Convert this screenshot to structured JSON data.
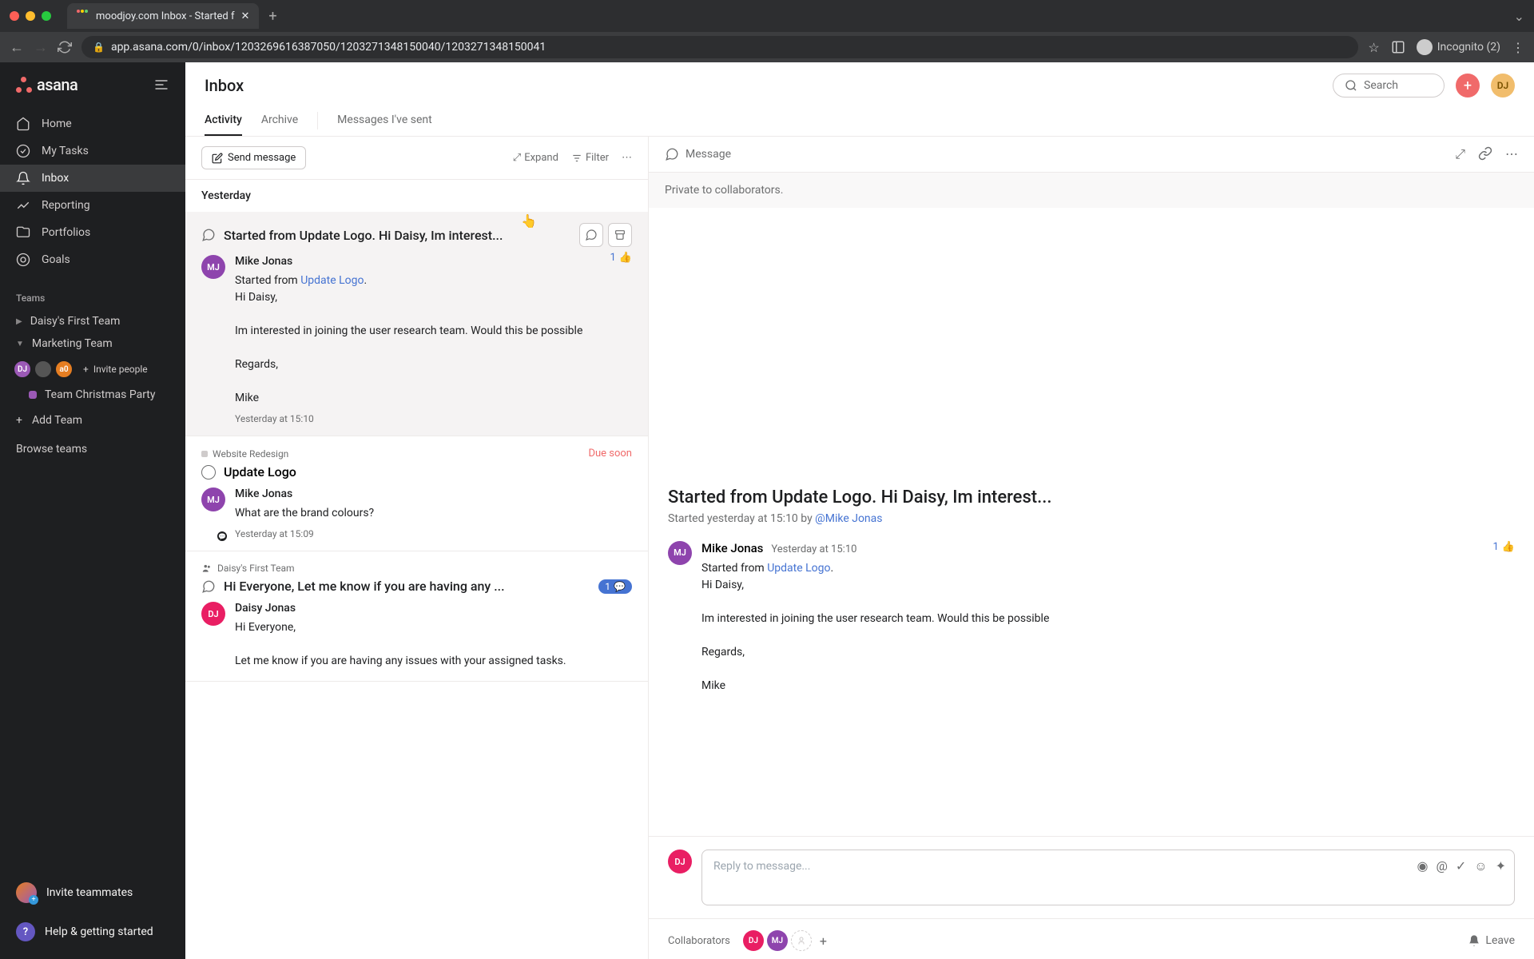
{
  "browser": {
    "tab_title": "moodjoy.com Inbox - Started f",
    "url": "app.asana.com/0/inbox/1203269616387050/1203271348150040/1203271348150041",
    "incognito_label": "Incognito (2)"
  },
  "sidebar": {
    "logo_text": "asana",
    "nav": {
      "home": "Home",
      "my_tasks": "My Tasks",
      "inbox": "Inbox",
      "reporting": "Reporting",
      "portfolios": "Portfolios",
      "goals": "Goals"
    },
    "teams_header": "Teams",
    "teams": [
      {
        "name": "Daisy's First Team"
      },
      {
        "name": "Marketing Team"
      }
    ],
    "invite_people": "Invite people",
    "projects": [
      {
        "name": "Team Christmas Party",
        "color": "#9b59b6"
      }
    ],
    "add_team": "Add Team",
    "browse_teams": "Browse teams",
    "invite_teammates": "Invite teammates",
    "help": "Help & getting started"
  },
  "header": {
    "title": "Inbox",
    "search_placeholder": "Search",
    "user_initials": "DJ",
    "tabs": {
      "activity": "Activity",
      "archive": "Archive",
      "messages_sent": "Messages I've sent"
    }
  },
  "inbox_toolbar": {
    "send_message": "Send message",
    "expand": "Expand",
    "filter": "Filter"
  },
  "date_header": "Yesterday",
  "items": [
    {
      "title": "Started from Update Logo. Hi Daisy, Im interest...",
      "author": "Mike Jonas",
      "author_initials": "MJ",
      "started_from_prefix": "Started from ",
      "started_from_link": "Update Logo",
      "greeting": "Hi Daisy,",
      "body1": "Im interested in joining the user research team. Would this be possible",
      "body2": "Regards,",
      "body3": "Mike",
      "time": "Yesterday at 15:10",
      "like_count": "1"
    },
    {
      "project": "Website Redesign",
      "due": "Due soon",
      "task_title": "Update Logo",
      "author": "Mike Jonas",
      "author_initials": "MJ",
      "body": "What are the brand colours?",
      "time": "Yesterday at 15:09"
    },
    {
      "team": "Daisy's First Team",
      "title": "Hi Everyone, Let me know if you are having any ...",
      "comment_count": "1",
      "author": "Daisy Jonas",
      "author_initials": "DJ",
      "greeting": "Hi Everyone,",
      "body": "Let me know if you are having any issues with your assigned tasks."
    }
  ],
  "detail": {
    "toolbar_label": "Message",
    "private_text": "Private to collaborators.",
    "title": "Started from Update Logo. Hi Daisy, Im interest...",
    "meta_prefix": "Started yesterday at 15:10 by ",
    "meta_link": "@Mike Jonas",
    "msg": {
      "author": "Mike Jonas",
      "author_initials": "MJ",
      "time": "Yesterday at 15:10",
      "like_count": "1",
      "started_from_prefix": "Started from ",
      "started_from_link": "Update Logo",
      "greeting": "Hi Daisy,",
      "body1": "Im interested in joining the user research team. Would this be possible",
      "body2": "Regards,",
      "body3": "Mike"
    },
    "reply_placeholder": "Reply to message...",
    "reply_avatar": "DJ",
    "collaborators_label": "Collaborators",
    "leave_label": "Leave"
  }
}
